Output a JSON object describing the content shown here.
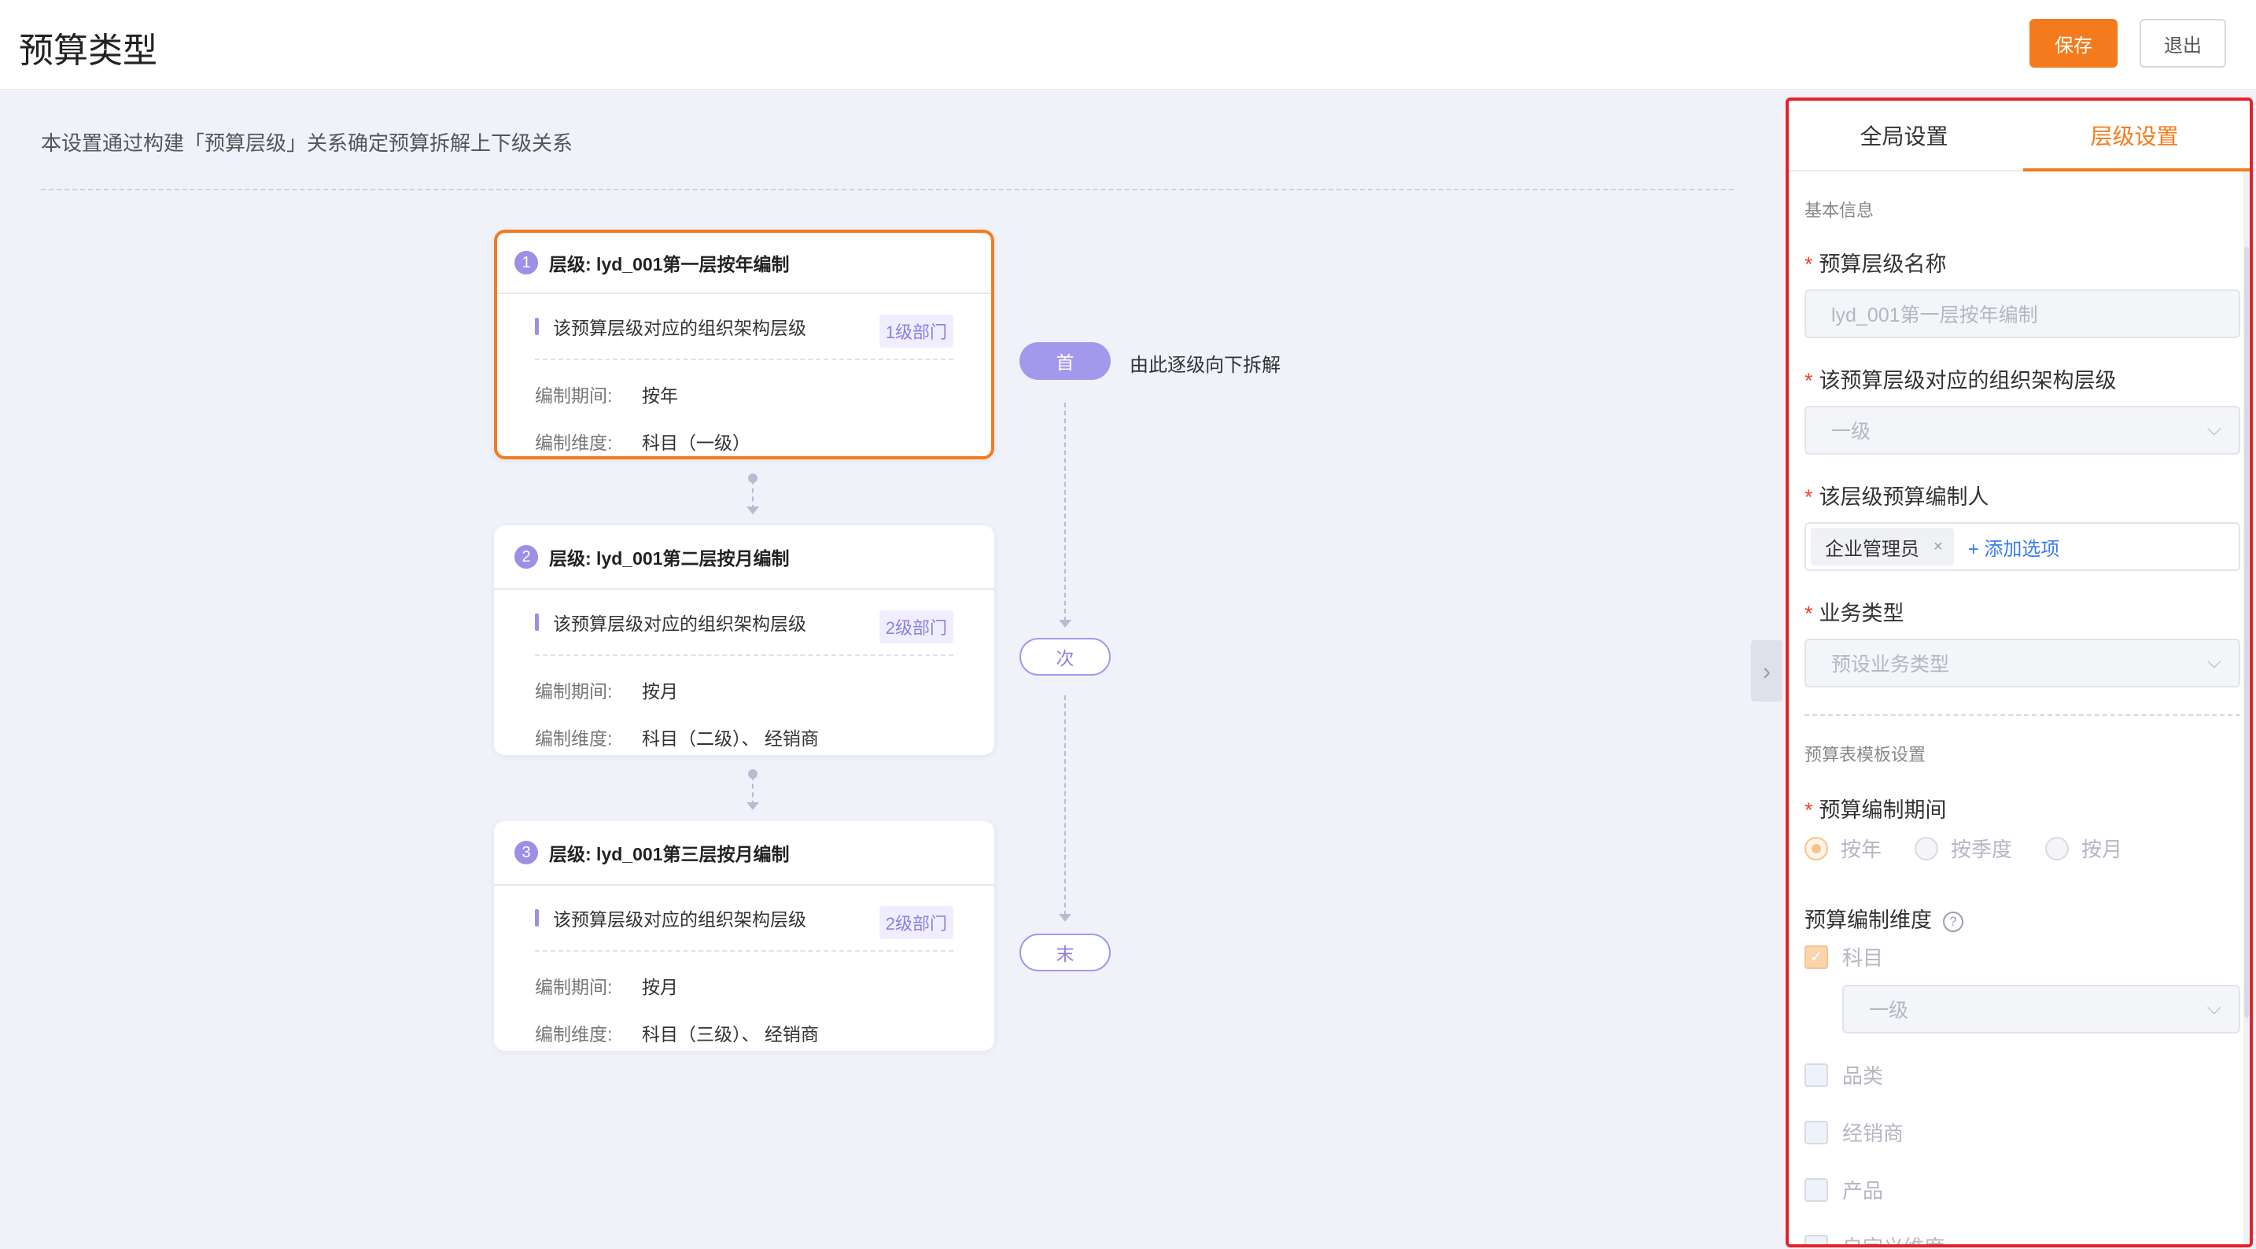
{
  "header": {
    "title": "预算类型",
    "save_label": "保存",
    "exit_label": "退出"
  },
  "intro_text": "本设置通过构建「预算层级」关系确定预算拆解上下级关系",
  "levels": [
    {
      "num": "1",
      "title": "层级: lyd_001第一层按年编制",
      "org_label": "该预算层级对应的组织架构层级",
      "org_tag": "1级部门",
      "period_key": "编制期间:",
      "period_val": "按年",
      "dim_key": "编制维度:",
      "dim_val": "科目（一级）"
    },
    {
      "num": "2",
      "title": "层级: lyd_001第二层按月编制",
      "org_label": "该预算层级对应的组织架构层级",
      "org_tag": "2级部门",
      "period_key": "编制期间:",
      "period_val": "按月",
      "dim_key": "编制维度:",
      "dim_val": "科目（二级）、 经销商"
    },
    {
      "num": "3",
      "title": "层级: lyd_001第三层按月编制",
      "org_label": "该预算层级对应的组织架构层级",
      "org_tag": "2级部门",
      "period_key": "编制期间:",
      "period_val": "按月",
      "dim_key": "编制维度:",
      "dim_val": "科目（三级）、 经销商"
    }
  ],
  "flow": {
    "first": "首",
    "next": "次",
    "last": "末",
    "description": "由此逐级向下拆解"
  },
  "panel": {
    "tabs": [
      "全局设置",
      "层级设置"
    ],
    "active_tab": "层级设置",
    "basic_section": "基本信息",
    "level_name_label": "预算层级名称",
    "level_name_value": "lyd_001第一层按年编制",
    "org_level_label": "该预算层级对应的组织架构层级",
    "org_level_value": "一级",
    "editor_label": "该层级预算编制人",
    "editor_tag": "企业管理员",
    "add_option": "+ 添加选项",
    "biz_type_label": "业务类型",
    "biz_type_placeholder": "预设业务类型",
    "template_section": "预算表模板设置",
    "period_label": "预算编制期间",
    "period_options": [
      "按年",
      "按季度",
      "按月"
    ],
    "period_selected": "按年",
    "dim_label": "预算编制维度",
    "dims": [
      "科目",
      "品类",
      "经销商",
      "产品",
      "自定义维度"
    ],
    "dim_checked": [
      "科目"
    ],
    "subject_level_value": "一级"
  }
}
